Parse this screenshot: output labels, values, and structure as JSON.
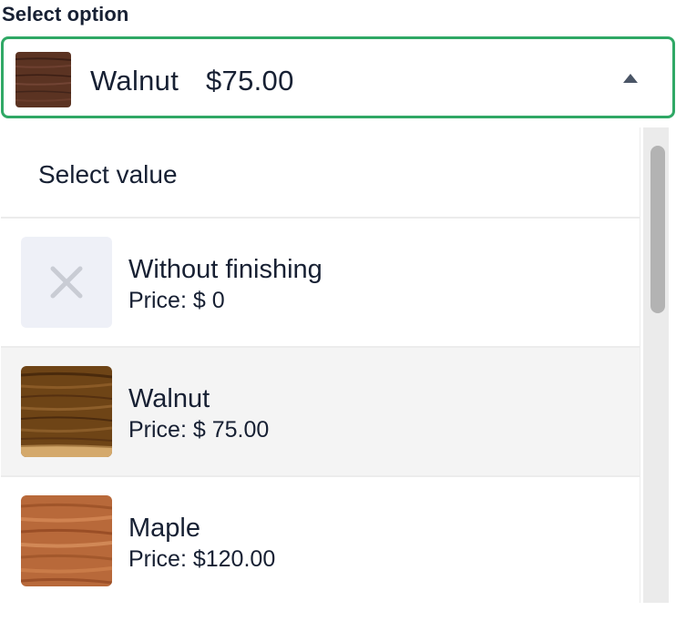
{
  "field": {
    "label": "Select option",
    "selected_name": "Walnut",
    "selected_price": "$75.00",
    "selected_swatch": "walnut",
    "caret_icon": "caret-up-icon"
  },
  "dropdown": {
    "placeholder": "Select value",
    "options": [
      {
        "name": "Without finishing",
        "price": "Price: $ 0",
        "swatch": "none",
        "icon": "x-icon"
      },
      {
        "name": "Walnut",
        "price": "Price: $ 75.00",
        "swatch": "walnut",
        "selected": true
      },
      {
        "name": "Maple",
        "price": "Price: $120.00",
        "swatch": "maple"
      }
    ]
  },
  "colors": {
    "accent_border": "#2fa865",
    "text": "#172033",
    "selected_row": "#f4f4f4"
  }
}
